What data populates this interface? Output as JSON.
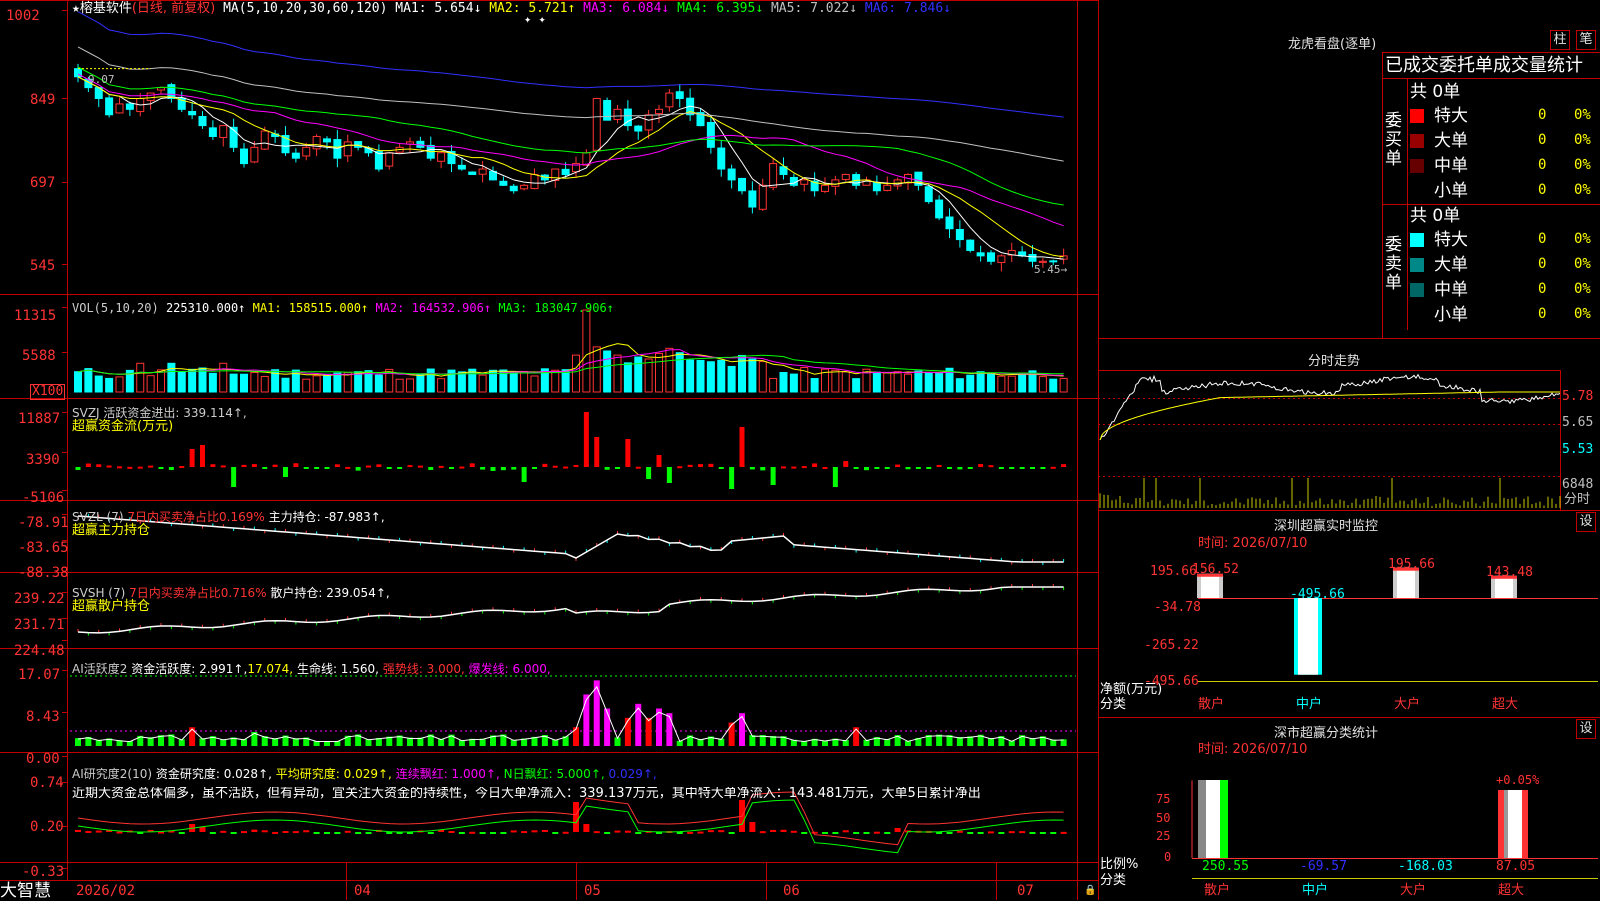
{
  "colors": {
    "up": "#ff3333",
    "down": "#00ffff",
    "border": "#c00000",
    "yellow": "#ffff00",
    "magenta": "#ff00ff",
    "green": "#00ff00",
    "gray": "#c0c0c0",
    "blue": "#3030ff",
    "white": "#ffffff"
  },
  "main": {
    "title_star": "★",
    "stock_name": "榕基软件",
    "period_note": "(日线, 前复权)",
    "ma_params": "MA(5,10,20,30,60,120)",
    "ma_values": [
      {
        "label": "MA1: 5.654↓",
        "color": "#ffffff"
      },
      {
        "label": "MA2: 5.721↑",
        "color": "#ffff00"
      },
      {
        "label": "MA3: 6.084↓",
        "color": "#ff00ff"
      },
      {
        "label": "MA4: 6.395↓",
        "color": "#00ff00"
      },
      {
        "label": "MA5: 7.022↓",
        "color": "#c0c0c0"
      },
      {
        "label": "MA6: 7.846↓",
        "color": "#3030ff"
      }
    ],
    "y_ticks": [
      "1002",
      "849",
      "697",
      "545"
    ],
    "high_label": "9.07",
    "low_label": "5.45→"
  },
  "vol": {
    "header": "VOL(5,10,20)",
    "value": "225310.000↑",
    "ma1": "MA1: 158515.000↑",
    "ma2": "MA2: 164532.906↑",
    "ma3": "MA3: 183047.906↑",
    "y_ticks": [
      "11315",
      "5588"
    ],
    "unit": "X100"
  },
  "svzj": {
    "header": "SVZJ  活跃资金进出: 339.114↑,",
    "subtitle": "超赢资金流(万元)",
    "y_ticks": [
      "11887",
      "3390",
      "-5106"
    ]
  },
  "svzl": {
    "header": "SVZL (7)",
    "pct": "7日内买卖净占比0.169%",
    "hold": "主力持仓: -87.983↑,",
    "subtitle": "超赢主力持仓",
    "y_ticks": [
      "-78.91",
      "-83.65",
      "-88.38"
    ]
  },
  "svsh": {
    "header": "SVSH (7)",
    "pct": "7日内买卖净占比0.716%",
    "hold": "散户持仓: 239.054↑,",
    "subtitle": "超赢散户持仓",
    "y_ticks": [
      "239.22",
      "231.71",
      "224.48"
    ]
  },
  "ai1": {
    "header": "AI活跃度2",
    "v1": "资金活跃度: 2.991↑,",
    "v2": "17.074,",
    "v3": "生命线: 1.560,",
    "v4": "强势线: 3.000,",
    "v5": "爆发线: 6.000,",
    "y_ticks": [
      "17.07",
      "8.43",
      "0.00"
    ]
  },
  "ai2": {
    "header": "AI研究度2(10)",
    "v1": "资金研究度: 0.028↑,",
    "v2": "平均研究度: 0.029↑,",
    "v3": "连续飘红: 1.000↑,",
    "v4": "N日飘红: 5.000↑,",
    "v5": "0.029↑,",
    "comment": "近期大资金总体偏多，虽不活跃，但有异动，宜关注大资金的持续性，今日大单净流入：339.137万元，其中特大单净流入：143.481万元，大单5日累计净出",
    "y_ticks": [
      "0.74",
      "0.20",
      "-0.33"
    ]
  },
  "xaxis": {
    "labels": [
      "2026/02",
      "04",
      "05",
      "06",
      "07"
    ]
  },
  "brand": "大智慧",
  "right": {
    "dragon_title": "龙虎看盘(逐单)",
    "btn_bar": "柱",
    "btn_tick": "笔",
    "table_title": "已成交委托单成交量统计",
    "buy": {
      "side": "委买单",
      "total": "共 0单",
      "rows": [
        {
          "name": "特大",
          "vol": "0",
          "pct": "0%",
          "color": "#ff0000"
        },
        {
          "name": "大单",
          "vol": "0",
          "pct": "0%",
          "color": "#990000"
        },
        {
          "name": "中单",
          "vol": "0",
          "pct": "0%",
          "color": "#660000"
        },
        {
          "name": "小单",
          "vol": "0",
          "pct": "0%",
          "color": ""
        }
      ]
    },
    "sell": {
      "side": "委卖单",
      "total": "共 0单",
      "rows": [
        {
          "name": "特大",
          "vol": "0",
          "pct": "0%",
          "color": "#00ffff"
        },
        {
          "name": "大单",
          "vol": "0",
          "pct": "0%",
          "color": "#008888"
        },
        {
          "name": "中单",
          "vol": "0",
          "pct": "0%",
          "color": "#006666"
        },
        {
          "name": "小单",
          "vol": "0",
          "pct": "0%",
          "color": ""
        }
      ]
    },
    "intraday": {
      "title": "分时走势",
      "ticks": [
        "5.78",
        "5.65",
        "5.53"
      ],
      "vol_tick": "6848",
      "unit": "分时"
    },
    "monitor": {
      "title": "深圳超赢实时监控",
      "btn": "设",
      "time": "时间: 2026/07/10",
      "y_ticks": [
        "195.66",
        "-34.78",
        "-265.22",
        "-495.66"
      ],
      "ylabel": "净额(万元)",
      "xlabel": "分类",
      "categories": [
        "散户",
        "中户",
        "大户",
        "超大"
      ],
      "values": [
        156.52,
        -495.66,
        195.66,
        143.48
      ],
      "value_labels": [
        "156.52",
        "-495.66",
        "195.66",
        "143.48"
      ]
    },
    "classify": {
      "title": "深市超赢分类统计",
      "btn": "设",
      "time": "时间: 2026/07/10",
      "y_ticks": [
        "75",
        "50",
        "25",
        "0"
      ],
      "ylabel": "比例%",
      "xlabel": "分类",
      "categories": [
        "散户",
        "中户",
        "大户",
        "超大"
      ],
      "bottom_values": [
        "250.55",
        "-69.57",
        "-168.03",
        "87.05"
      ],
      "top_label": "+0.05%"
    }
  },
  "chart_data": [
    {
      "type": "candlestick",
      "title": "榕基软件 (日线, 前复权)",
      "ylim": [
        5.2,
        10.1
      ],
      "y_tick_labels": [
        "1002",
        "849",
        "697",
        "545"
      ],
      "note": "approximate daily OHLC read visually, Jan–Jul 2026",
      "closes": [
        8.9,
        8.7,
        8.5,
        8.2,
        8.4,
        8.3,
        8.5,
        8.6,
        8.7,
        8.5,
        8.3,
        8.2,
        8.0,
        7.8,
        8.0,
        7.6,
        7.3,
        7.6,
        7.9,
        7.8,
        7.5,
        7.4,
        7.6,
        7.8,
        7.7,
        7.4,
        7.7,
        7.6,
        7.5,
        7.2,
        7.5,
        7.6,
        7.7,
        7.6,
        7.4,
        7.5,
        7.3,
        7.2,
        7.1,
        7.2,
        7.0,
        6.9,
        6.8,
        6.9,
        7.1,
        7.0,
        7.2,
        7.1,
        7.3,
        7.5,
        8.5,
        8.1,
        8.3,
        8.0,
        7.9,
        8.2,
        8.3,
        8.6,
        8.5,
        8.2,
        8.0,
        7.6,
        7.2,
        7.0,
        6.8,
        6.5,
        6.9,
        7.3,
        7.1,
        6.9,
        7.0,
        6.8,
        6.9,
        7.0,
        7.1,
        6.9,
        7.0,
        6.8,
        6.9,
        7.0,
        7.1,
        6.9,
        6.6,
        6.3,
        6.1,
        5.9,
        5.7,
        5.6,
        5.5,
        5.6,
        5.7,
        5.6,
        5.5,
        5.5,
        5.5,
        5.6
      ]
    },
    {
      "type": "bar",
      "title": "VOL(5,10,20)",
      "y_tick_labels": [
        "11315",
        "5588"
      ]
    },
    {
      "type": "bar",
      "title": "超赢资金流(万元)",
      "y_tick_labels": [
        "11887",
        "3390",
        "-5106"
      ]
    },
    {
      "type": "line",
      "title": "超赢主力持仓",
      "y_tick_labels": [
        "-78.91",
        "-83.65",
        "-88.38"
      ]
    },
    {
      "type": "line",
      "title": "超赢散户持仓",
      "y_tick_labels": [
        "239.22",
        "231.71",
        "224.48"
      ]
    },
    {
      "type": "bar",
      "title": "AI活跃度2",
      "y_tick_labels": [
        "17.07",
        "8.43",
        "0.00"
      ]
    },
    {
      "type": "bar",
      "title": "AI研究度2(10)",
      "y_tick_labels": [
        "0.74",
        "0.20",
        "-0.33"
      ]
    },
    {
      "type": "bar",
      "title": "深圳超赢实时监控",
      "categories": [
        "散户",
        "中户",
        "大户",
        "超大"
      ],
      "values": [
        156.52,
        -495.66,
        195.66,
        143.48
      ],
      "ylabel": "净额(万元)",
      "xlabel": "分类"
    },
    {
      "type": "bar",
      "title": "深市超赢分类统计",
      "categories": [
        "散户",
        "中户",
        "大户",
        "超大"
      ],
      "values": [
        250.55,
        -69.57,
        -168.03,
        87.05
      ],
      "ylabel": "比例%",
      "xlabel": "分类"
    }
  ]
}
